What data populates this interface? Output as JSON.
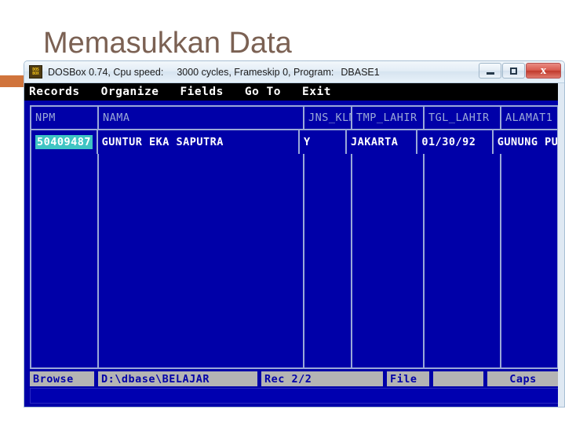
{
  "slide": {
    "title": "Memasukkan Data",
    "accent_color": "#d0743c",
    "title_color": "#7b6153"
  },
  "window": {
    "icon_name": "dosbox-icon",
    "icon_line1": "DOS",
    "icon_line2": "BOX",
    "title_part1": "DOSBox 0.74, Cpu speed:",
    "title_part2": "3000 cycles, Frameskip  0, Program:",
    "title_part3": "DBASE1",
    "controls": {
      "minimize": "–",
      "maximize": "□",
      "close": "x"
    }
  },
  "menubar": {
    "items": [
      {
        "label": "Records"
      },
      {
        "label": "Organize"
      },
      {
        "label": "Fields"
      },
      {
        "label": "Go To"
      },
      {
        "label": "Exit"
      }
    ]
  },
  "browse": {
    "columns": [
      "NPM",
      "NAMA",
      "JNS_KLM",
      "TMP_LAHIR",
      "TGL_LAHIR",
      "ALAMAT1"
    ],
    "rows": [
      {
        "NPM": "50409487",
        "NAMA": "GUNTUR EKA SAPUTRA",
        "JNS_KLM": "Y",
        "TMP_LAHIR": "JAKARTA",
        "TGL_LAHIR": "01/30/92",
        "ALAMAT1": "GUNUNG PU"
      }
    ],
    "selected_cell": {
      "row": 0,
      "column": "NPM"
    },
    "colors": {
      "screen_background": "#0000a8",
      "grid_line": "#9aa8d8",
      "header_text": "#9aa8d8",
      "data_text": "#ffffff",
      "selection_background": "#3fc4c4"
    }
  },
  "statusbar": {
    "mode": "Browse",
    "path": "D:\\dbase\\BELAJAR",
    "record": "Rec 2/2",
    "file": "File",
    "blank": "",
    "caps": "Caps"
  }
}
